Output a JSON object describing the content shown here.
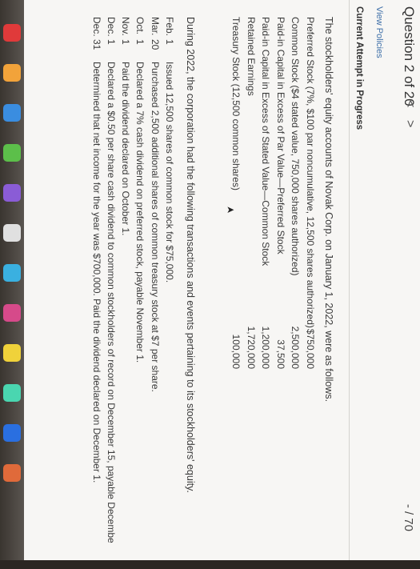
{
  "header": {
    "question": "Question 2 of 20",
    "prev": "<",
    "next": ">",
    "score": "- / 70"
  },
  "links": {
    "view_policies": "View Policies"
  },
  "attempt_status": "Current Attempt in Progress",
  "intro": "The stockholders' equity accounts of Novak Corp. on January 1, 2022, were as follows.",
  "equity": [
    {
      "label": "Preferred Stock (7%, $100 par noncumulative, 12,500 shares authorized)",
      "amount": "$750,000"
    },
    {
      "label": "Common Stock ($4 stated value, 750,000 shares authorized)",
      "amount": "2,500,000"
    },
    {
      "label": "Paid-in Capital in Excess of Par Value—Preferred Stock",
      "amount": "37,500"
    },
    {
      "label": "Paid-in Capital in Excess of Stated Value—Common Stock",
      "amount": "1,200,000"
    },
    {
      "label": "Retained Earnings",
      "amount": "1,720,000"
    },
    {
      "label": "Treasury Stock (12,500 common shares)",
      "amount": "100,000"
    }
  ],
  "during": "During 2022, the corporation had the following transactions and events pertaining to its stockholders' equity.",
  "transactions": [
    {
      "month": "Feb.",
      "day": "1",
      "desc": "Issued 12,500 shares of common stock for $75,000."
    },
    {
      "month": "Mar.",
      "day": "20",
      "desc": "Purchased 2,500 additional shares of common treasury stock at $7 per share."
    },
    {
      "month": "Oct.",
      "day": "1",
      "desc": "Declared a 7% cash dividend on preferred stock, payable November 1."
    },
    {
      "month": "Nov.",
      "day": "1",
      "desc": "Paid the dividend declared on October 1."
    },
    {
      "month": "Dec.",
      "day": "1",
      "desc": "Declared a $0.50 per share cash dividend to common stockholders of record on December 15, payable Decembe"
    },
    {
      "month": "Dec.",
      "day": "31",
      "desc": "Determined that net income for the year was $700,000. Paid the dividend declared on December 1."
    }
  ],
  "dock_colors": [
    "#e03a3a",
    "#f2a33a",
    "#3a8de0",
    "#5cbf4a",
    "#8a5cd6",
    "#e0e0e0",
    "#3ab0e0",
    "#d64a8a",
    "#f0d23a",
    "#4ad6b0",
    "#2a6fe0",
    "#e06a3a"
  ]
}
